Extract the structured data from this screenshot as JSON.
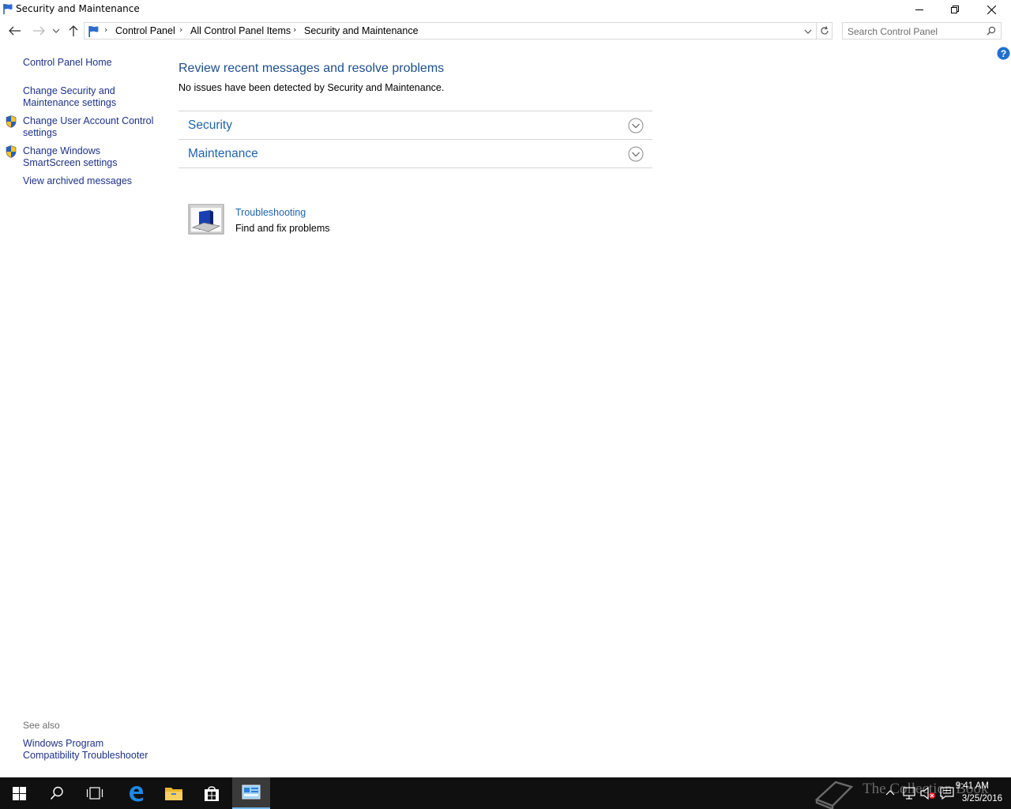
{
  "window": {
    "title": "Security and Maintenance",
    "controls": {
      "minimize": "minimize-icon",
      "restore": "restore-icon",
      "close": "close-icon"
    }
  },
  "address": {
    "breadcrumbs": [
      "Control Panel",
      "All Control Panel Items",
      "Security and Maintenance"
    ],
    "search_placeholder": "Search Control Panel"
  },
  "sidebar": {
    "home": "Control Panel Home",
    "links": [
      {
        "label": "Change Security and Maintenance settings",
        "shield": false
      },
      {
        "label": "Change User Account Control settings",
        "shield": true
      },
      {
        "label": "Change Windows SmartScreen settings",
        "shield": true
      },
      {
        "label": "View archived messages",
        "shield": false
      }
    ],
    "see_also_label": "See also",
    "see_also_links": [
      "Windows Program Compatibility Troubleshooter"
    ]
  },
  "main": {
    "title": "Review recent messages and resolve problems",
    "description": "No issues have been detected by Security and Maintenance.",
    "sections": [
      {
        "label": "Security",
        "expanded": false
      },
      {
        "label": "Maintenance",
        "expanded": false
      }
    ],
    "troubleshooting": {
      "title": "Troubleshooting",
      "description": "Find and fix problems"
    }
  },
  "taskbar": {
    "items": [
      "start-icon",
      "search-icon",
      "task-view-icon",
      "edge-icon",
      "file-explorer-icon",
      "store-icon",
      "control-panel-icon"
    ],
    "watermark": "The Collection Book",
    "time": "9:41 AM",
    "date": "3/25/2016",
    "accent": "#76b9ed"
  },
  "colors": {
    "link": "#1e3287",
    "heading": "#1e4e8c",
    "section": "#1e64a8"
  }
}
